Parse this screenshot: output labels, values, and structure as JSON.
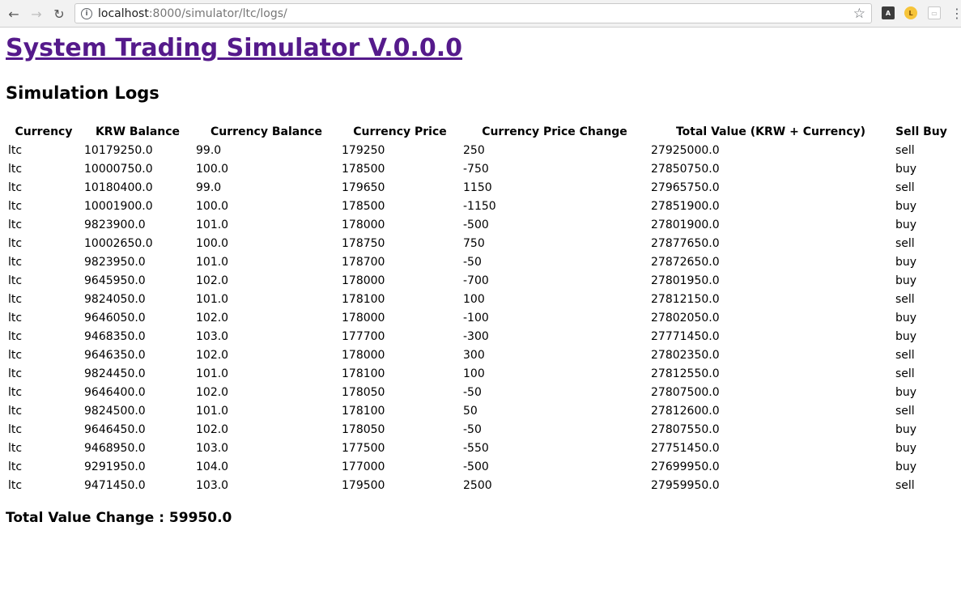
{
  "browser": {
    "url_host": "localhost",
    "url_port": ":8000",
    "url_path": "/simulator/ltc/logs/",
    "back_icon": "arrow-left-icon",
    "forward_icon": "arrow-right-icon",
    "reload_icon": "reload-icon",
    "info_icon": "info-icon",
    "bookmark_icon": "star-icon"
  },
  "page": {
    "site_title": "System Trading Simulator V.0.0.0",
    "section_title": "Simulation Logs",
    "total_value_change": "Total Value Change : 59950.0"
  },
  "table": {
    "headers": [
      "Currency",
      "KRW Balance",
      "Currency Balance",
      "Currency Price",
      "Currency Price Change",
      "Total Value (KRW + Currency)",
      "Sell Buy"
    ],
    "rows": [
      [
        "ltc",
        "10179250.0",
        "99.0",
        "179250",
        "250",
        "27925000.0",
        "sell"
      ],
      [
        "ltc",
        "10000750.0",
        "100.0",
        "178500",
        "-750",
        "27850750.0",
        "buy"
      ],
      [
        "ltc",
        "10180400.0",
        "99.0",
        "179650",
        "1150",
        "27965750.0",
        "sell"
      ],
      [
        "ltc",
        "10001900.0",
        "100.0",
        "178500",
        "-1150",
        "27851900.0",
        "buy"
      ],
      [
        "ltc",
        "9823900.0",
        "101.0",
        "178000",
        "-500",
        "27801900.0",
        "buy"
      ],
      [
        "ltc",
        "10002650.0",
        "100.0",
        "178750",
        "750",
        "27877650.0",
        "sell"
      ],
      [
        "ltc",
        "9823950.0",
        "101.0",
        "178700",
        "-50",
        "27872650.0",
        "buy"
      ],
      [
        "ltc",
        "9645950.0",
        "102.0",
        "178000",
        "-700",
        "27801950.0",
        "buy"
      ],
      [
        "ltc",
        "9824050.0",
        "101.0",
        "178100",
        "100",
        "27812150.0",
        "sell"
      ],
      [
        "ltc",
        "9646050.0",
        "102.0",
        "178000",
        "-100",
        "27802050.0",
        "buy"
      ],
      [
        "ltc",
        "9468350.0",
        "103.0",
        "177700",
        "-300",
        "27771450.0",
        "buy"
      ],
      [
        "ltc",
        "9646350.0",
        "102.0",
        "178000",
        "300",
        "27802350.0",
        "sell"
      ],
      [
        "ltc",
        "9824450.0",
        "101.0",
        "178100",
        "100",
        "27812550.0",
        "sell"
      ],
      [
        "ltc",
        "9646400.0",
        "102.0",
        "178050",
        "-50",
        "27807500.0",
        "buy"
      ],
      [
        "ltc",
        "9824500.0",
        "101.0",
        "178100",
        "50",
        "27812600.0",
        "sell"
      ],
      [
        "ltc",
        "9646450.0",
        "102.0",
        "178050",
        "-50",
        "27807550.0",
        "buy"
      ],
      [
        "ltc",
        "9468950.0",
        "103.0",
        "177500",
        "-550",
        "27751450.0",
        "buy"
      ],
      [
        "ltc",
        "9291950.0",
        "104.0",
        "177000",
        "-500",
        "27699950.0",
        "buy"
      ],
      [
        "ltc",
        "9471450.0",
        "103.0",
        "179500",
        "2500",
        "27959950.0",
        "sell"
      ]
    ]
  }
}
